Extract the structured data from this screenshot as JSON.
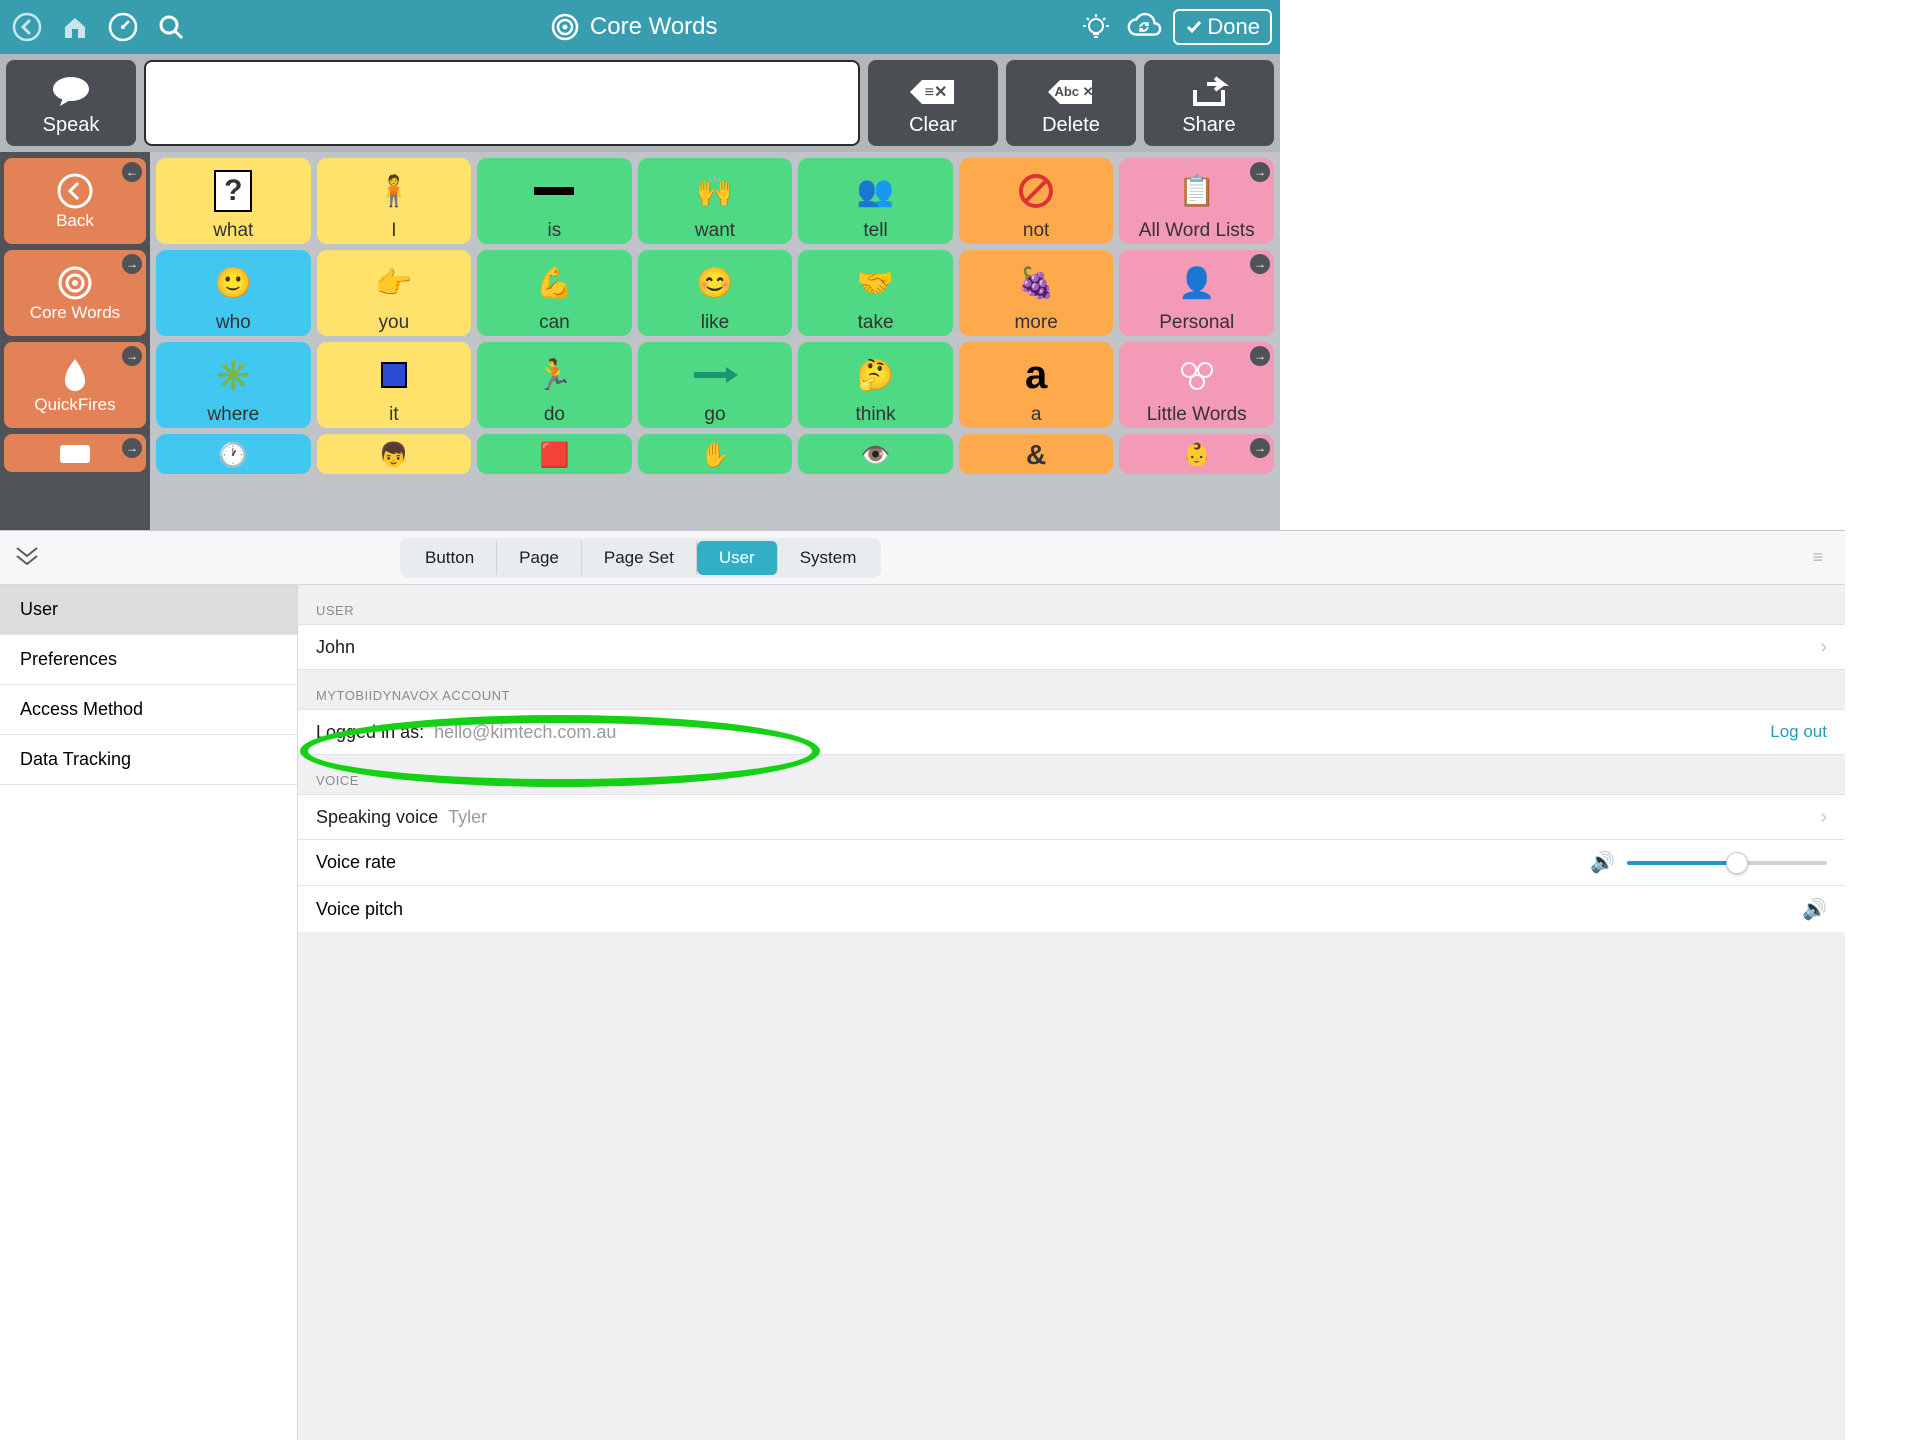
{
  "header": {
    "title": "Core Words",
    "done": "Done"
  },
  "toolbar": {
    "speak": "Speak",
    "clear": "Clear",
    "delete": "Delete",
    "share": "Share"
  },
  "nav": {
    "back": "Back",
    "core": "Core Words",
    "quick": "QuickFires"
  },
  "grid": {
    "r1": [
      "what",
      "I",
      "is",
      "want",
      "tell",
      "not",
      "All Word Lists"
    ],
    "r2": [
      "who",
      "you",
      "can",
      "like",
      "take",
      "more",
      "Personal"
    ],
    "r3": [
      "where",
      "it",
      "do",
      "go",
      "think",
      "a",
      "Little Words"
    ]
  },
  "tabs": {
    "button": "Button",
    "page": "Page",
    "pageset": "Page Set",
    "user": "User",
    "system": "System"
  },
  "side": {
    "user": "User",
    "prefs": "Preferences",
    "access": "Access Method",
    "data": "Data Tracking"
  },
  "sections": {
    "user_h": "USER",
    "user_name": "John",
    "acct_h": "MYTOBIIDYNAVOX ACCOUNT",
    "logged_label": "Logged in as:",
    "logged_email": "hello@kimtech.com.au",
    "logout": "Log out",
    "voice_h": "VOICE",
    "speaking_label": "Speaking voice",
    "speaking_val": "Tyler",
    "rate": "Voice rate",
    "pitch": "Voice pitch"
  }
}
